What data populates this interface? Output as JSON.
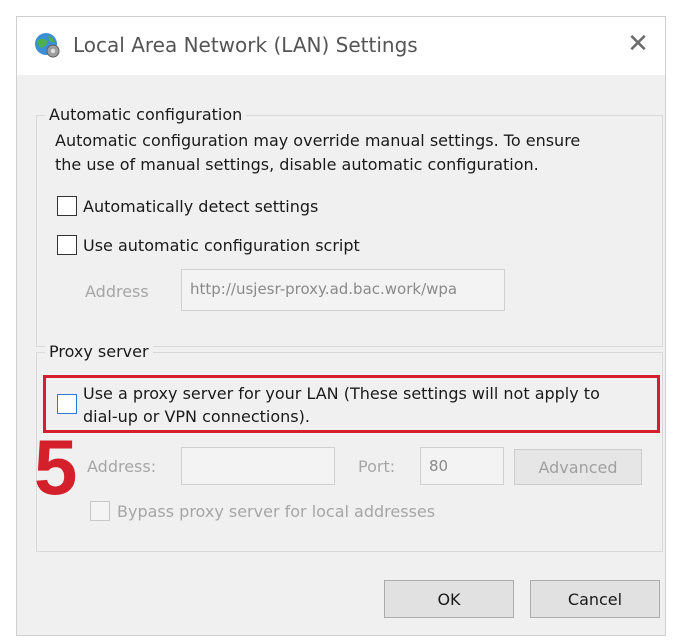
{
  "window": {
    "title": "Local Area Network (LAN) Settings",
    "app_icon": "globe-settings-icon",
    "close_icon": "close-icon",
    "close_glyph": "✕"
  },
  "automatic_configuration": {
    "group_label": "Automatic configuration",
    "description_line1": "Automatic configuration may override manual settings.  To ensure",
    "description_line2": "the use of manual settings, disable automatic configuration.",
    "auto_detect_label": "Automatically detect settings",
    "auto_detect_checked": false,
    "use_script_label": "Use automatic configuration script",
    "use_script_checked": false,
    "address_label": "Address",
    "address_value": "http://usjesr-proxy.ad.bac.work/wpa"
  },
  "proxy_server": {
    "group_label": "Proxy server",
    "use_proxy_label_line1": "Use a proxy server for your LAN (These settings will not apply to",
    "use_proxy_label_line2": "dial-up or VPN connections).",
    "use_proxy_checked": false,
    "address_label": "Address:",
    "address_value": "",
    "port_label": "Port:",
    "port_value": "80",
    "advanced_label": "Advanced",
    "bypass_label": "Bypass proxy server for local addresses",
    "bypass_checked": false
  },
  "annotation": {
    "step_number": "5",
    "highlight_color": "#d4202a"
  },
  "buttons": {
    "ok_label": "OK",
    "cancel_label": "Cancel"
  },
  "colors": {
    "accent": "#2b7cd3",
    "dialog_bg": "#f0f0f0"
  }
}
